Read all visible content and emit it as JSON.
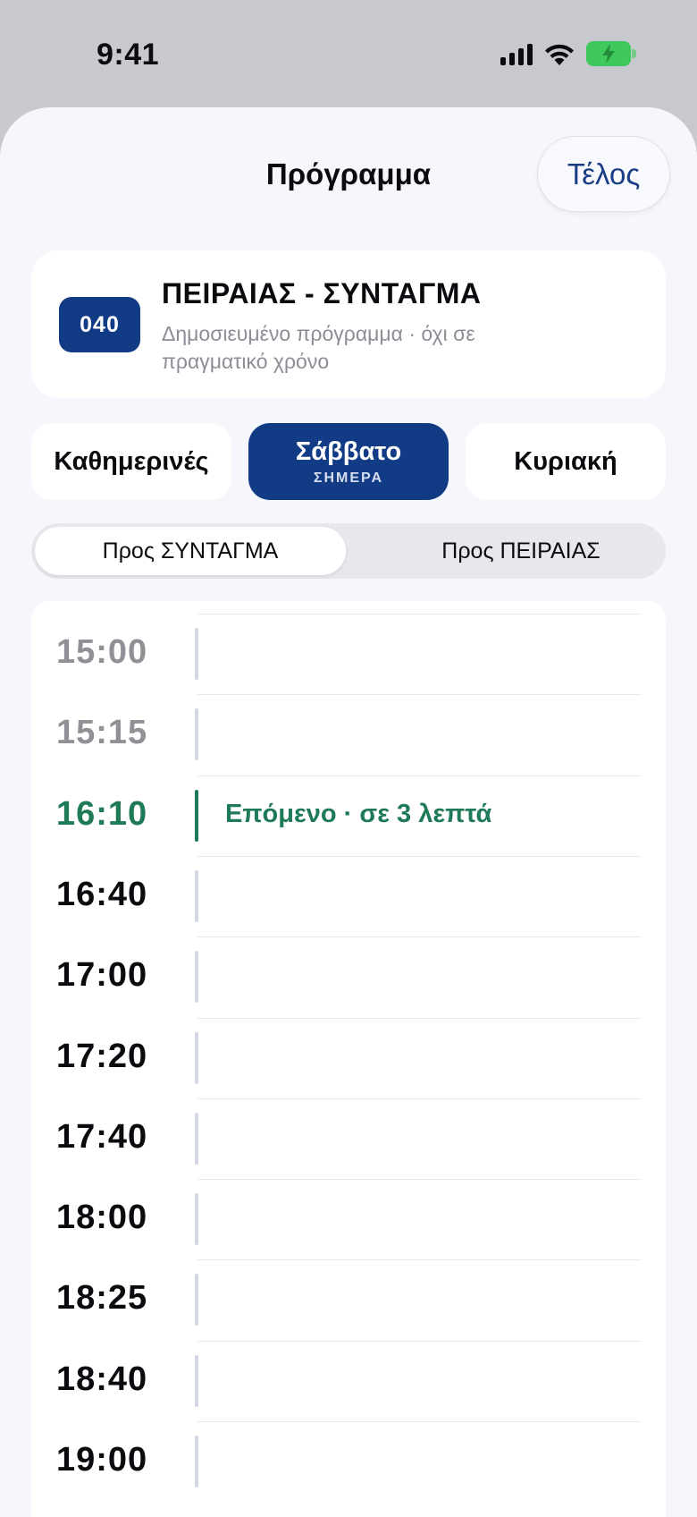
{
  "status_bar": {
    "time": "9:41"
  },
  "header": {
    "title": "Πρόγραμμα",
    "done_label": "Τέλος"
  },
  "route": {
    "number": "040",
    "name": "ΠΕΙΡΑΙΑΣ - ΣΥΝΤΑΓΜΑ",
    "subtitle": "Δημοσιευμένο πρόγραμμα · όχι σε πραγματικό χρόνο"
  },
  "day_tabs": [
    {
      "label": "Καθημερινές",
      "sub": "",
      "active": false
    },
    {
      "label": "Σάββατο",
      "sub": "ΣΗΜΕΡΑ",
      "active": true
    },
    {
      "label": "Κυριακή",
      "sub": "",
      "active": false
    }
  ],
  "directions": [
    {
      "label": "Προς ΣΥΝΤΑΓΜΑ",
      "active": true
    },
    {
      "label": "Προς ΠΕΙΡΑΙΑΣ",
      "active": false
    }
  ],
  "schedule": [
    {
      "time": "15:00",
      "state": "past",
      "note": ""
    },
    {
      "time": "15:15",
      "state": "past",
      "note": ""
    },
    {
      "time": "16:10",
      "state": "next",
      "note": "Επόμενο · σε 3 λεπτά"
    },
    {
      "time": "16:40",
      "state": "upcoming",
      "note": ""
    },
    {
      "time": "17:00",
      "state": "upcoming",
      "note": ""
    },
    {
      "time": "17:20",
      "state": "upcoming",
      "note": ""
    },
    {
      "time": "17:40",
      "state": "upcoming",
      "note": ""
    },
    {
      "time": "18:00",
      "state": "upcoming",
      "note": ""
    },
    {
      "time": "18:25",
      "state": "upcoming",
      "note": ""
    },
    {
      "time": "18:40",
      "state": "upcoming",
      "note": ""
    },
    {
      "time": "19:00",
      "state": "upcoming",
      "note": ""
    }
  ],
  "colors": {
    "accent": "#123b85",
    "next": "#1f7a58",
    "past": "#8f9196",
    "battery": "#3fc85b"
  }
}
